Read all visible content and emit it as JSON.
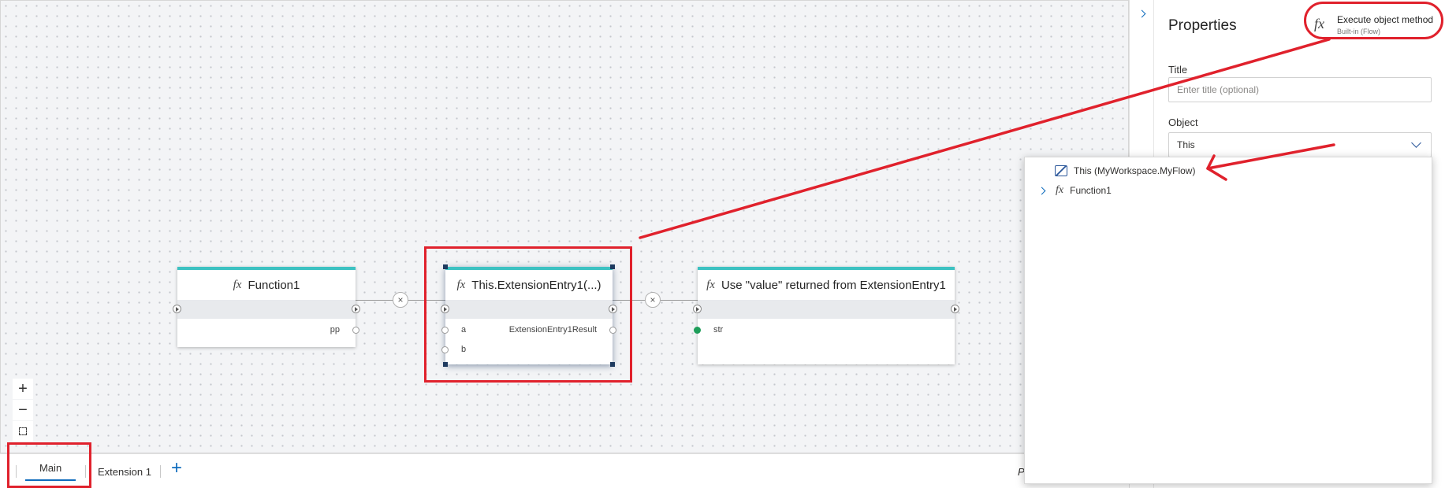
{
  "canvas": {
    "zoom_in_icon": "plus-icon",
    "zoom_out_icon": "minus-icon",
    "fit_icon": "fit-screen-icon"
  },
  "nodes": [
    {
      "title": "Function1",
      "icon": "fx-icon",
      "outputs": [
        "pp"
      ],
      "inputs": []
    },
    {
      "title": "This.ExtensionEntry1(...)",
      "icon": "fx-icon",
      "inputs": [
        "a",
        "b"
      ],
      "outputs": [
        "ExtensionEntry1Result"
      ]
    },
    {
      "title": "Use \"value\" returned from ExtensionEntry1",
      "icon": "fx-icon",
      "inputs": [
        "str"
      ],
      "outputs": []
    }
  ],
  "connector_symbol": "×",
  "tabs": {
    "main": "Main",
    "extension": "Extension 1",
    "add": "+",
    "hidden_label": "P"
  },
  "properties": {
    "header": "Properties",
    "node_type": "Execute object method",
    "node_subtitle": "Built-in (Flow)",
    "title_label": "Title",
    "title_placeholder": "Enter title (optional)",
    "object_label": "Object",
    "object_value": "This"
  },
  "dropdown": {
    "options": [
      {
        "label": "This (MyWorkspace.MyFlow)",
        "icon": "object-icon"
      },
      {
        "label": "Function1",
        "icon": "fx-icon"
      }
    ]
  },
  "colors": {
    "node_accent": "#3cc2c2",
    "annotation_red": "#e0212c",
    "link_blue": "#0f6cbd",
    "pin_green": "#1e9e5a"
  }
}
